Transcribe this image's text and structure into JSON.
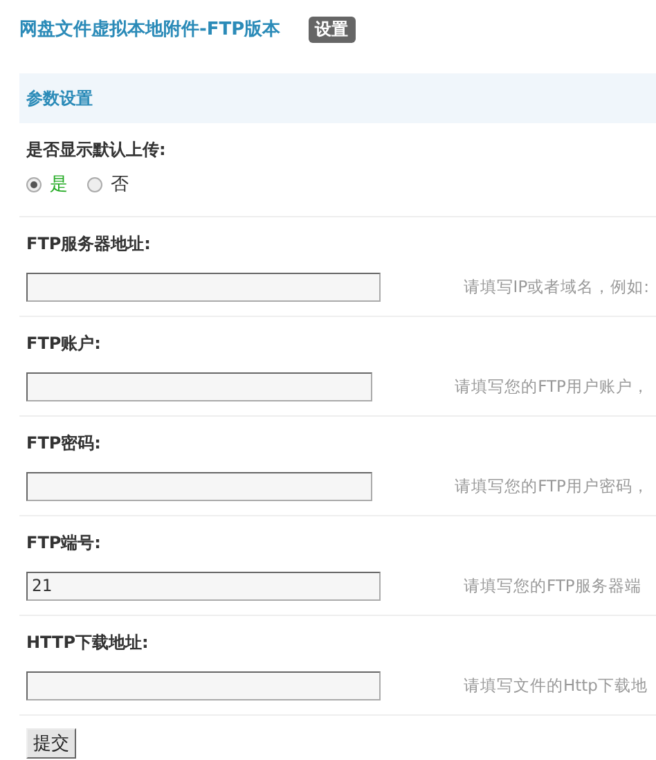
{
  "header": {
    "title": "网盘文件虚拟本地附件-FTP版本",
    "badge": "设置"
  },
  "section": {
    "title": "参数设置"
  },
  "radio_setting": {
    "label": "是否显示默认上传:",
    "options": [
      {
        "label": "是",
        "selected": true
      },
      {
        "label": "否",
        "selected": false
      }
    ]
  },
  "fields": [
    {
      "label": "FTP服务器地址:",
      "hint": "请填写IP或者域名，例如:"
    },
    {
      "label": "FTP账户:",
      "hint": "请填写您的FTP用户账户，"
    },
    {
      "label": "FTP密码:",
      "hint": "请填写您的FTP用户密码，"
    },
    {
      "label": "FTP端号:",
      "value": "21",
      "hint": "请填写您的FTP服务器端"
    },
    {
      "label": "HTTP下载地址:",
      "hint": "请填写文件的Http下载地"
    }
  ],
  "submit": "提交"
}
